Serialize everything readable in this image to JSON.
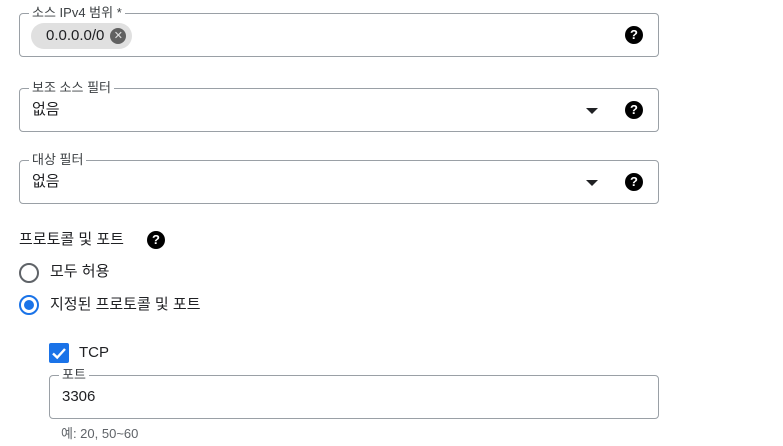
{
  "source_ip": {
    "label": "소스 IPv4 범위 *",
    "chips": [
      "0.0.0.0/0"
    ],
    "help_icon": "help-icon"
  },
  "secondary_source_filter": {
    "label": "보조 소스 필터",
    "value": "없음"
  },
  "target_filter": {
    "label": "대상 필터",
    "value": "없음"
  },
  "protocols_ports": {
    "heading": "프로토콜 및 포트",
    "options": [
      {
        "label": "모두 허용",
        "checked": false
      },
      {
        "label": "지정된 프로토콜 및 포트",
        "checked": true
      }
    ],
    "tcp": {
      "label": "TCP",
      "checked": true,
      "ports_label": "포트",
      "ports_value": "3306",
      "hint": "예: 20, 50~60"
    }
  },
  "colors": {
    "accent": "#1a73e8",
    "border": "#9aa0a6"
  }
}
